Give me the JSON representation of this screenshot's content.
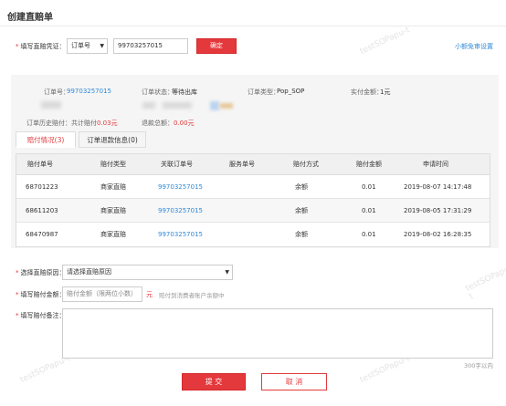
{
  "title": "创建直赔单",
  "voucher": {
    "label": "填写直赔凭证：",
    "type_select": "订单号",
    "order_input": "99703257015",
    "confirm": "确定",
    "right_link": "小额免审设置"
  },
  "info": {
    "order_no_label": "订单号：",
    "order_no": "99703257015",
    "status_label": "订单状态：",
    "status": "等待出库",
    "type_label": "订单类型：",
    "type": "Pop_SOP",
    "paid_label": "实付金额：",
    "paid": "1元",
    "history_label": "订单历史赔付：",
    "history_prefix": "共计赔付",
    "history_amount": "0.03元",
    "refund_label": "退款总额：",
    "refund_amount": "0.00元"
  },
  "tabs": [
    {
      "label": "赔付情况(3)"
    },
    {
      "label": "订单退款信息(0)"
    }
  ],
  "table": {
    "headers": [
      "赔付单号",
      "赔付类型",
      "关联订单号",
      "服务单号",
      "赔付方式",
      "赔付金额",
      "申请时间"
    ],
    "rows": [
      [
        "68701223",
        "商家直赔",
        "99703257015",
        "",
        "余额",
        "0.01",
        "2019-08-07 14:17:48"
      ],
      [
        "68611203",
        "商家直赔",
        "99703257015",
        "",
        "余额",
        "0.01",
        "2019-08-05 17:31:29"
      ],
      [
        "68470987",
        "商家直赔",
        "99703257015",
        "",
        "余额",
        "0.01",
        "2019-08-02 16:28:35"
      ]
    ]
  },
  "form": {
    "reason_label": "选择直赔原因：",
    "reason_select": "请选择直赔原因",
    "amount_label": "填写赔付金额：",
    "amount_placeholder": "赔付金额（限两位小数）",
    "amount_unit": "元",
    "amount_hint": "赔付到消费者账户余额中",
    "remark_label": "填写赔付备注：",
    "remark_counter": "300字以内"
  },
  "buttons": {
    "submit": "提 交",
    "cancel": "取 消"
  },
  "watermark": "testSOPapu-t"
}
